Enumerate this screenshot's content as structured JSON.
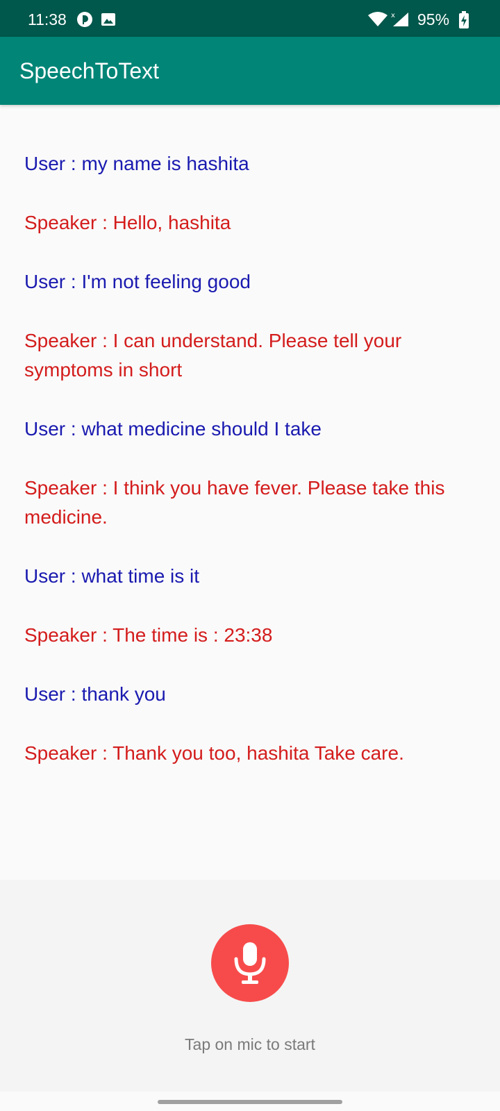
{
  "status_bar": {
    "time": "11:38",
    "battery": "95%",
    "icons": [
      "circle-app-icon",
      "image-icon",
      "wifi-icon",
      "signal-icon",
      "battery-charging-icon"
    ]
  },
  "app_bar": {
    "title": "SpeechToText"
  },
  "conversation": [
    {
      "role": "user",
      "text": "User : my name is hashita"
    },
    {
      "role": "speaker",
      "text": "Speaker : Hello, hashita"
    },
    {
      "role": "user",
      "text": "User : I'm not feeling good"
    },
    {
      "role": "speaker",
      "text": "Speaker : I can understand. Please tell your symptoms in short"
    },
    {
      "role": "user",
      "text": "User : what medicine should I take"
    },
    {
      "role": "speaker",
      "text": "Speaker : I think you have fever. Please take this medicine."
    },
    {
      "role": "user",
      "text": "User : what time is it"
    },
    {
      "role": "speaker",
      "text": "Speaker : The time is : 23:38"
    },
    {
      "role": "user",
      "text": "User : thank you"
    },
    {
      "role": "speaker",
      "text": "Speaker : Thank you too, hashita Take care."
    }
  ],
  "controls": {
    "mic_icon": "microphone-icon",
    "hint": "Tap on mic to start"
  },
  "colors": {
    "status_bar": "#00574b",
    "app_bar": "#008577",
    "user_text": "#1a1ab0",
    "speaker_text": "#d41c1c",
    "mic_button": "#f74b4b"
  }
}
